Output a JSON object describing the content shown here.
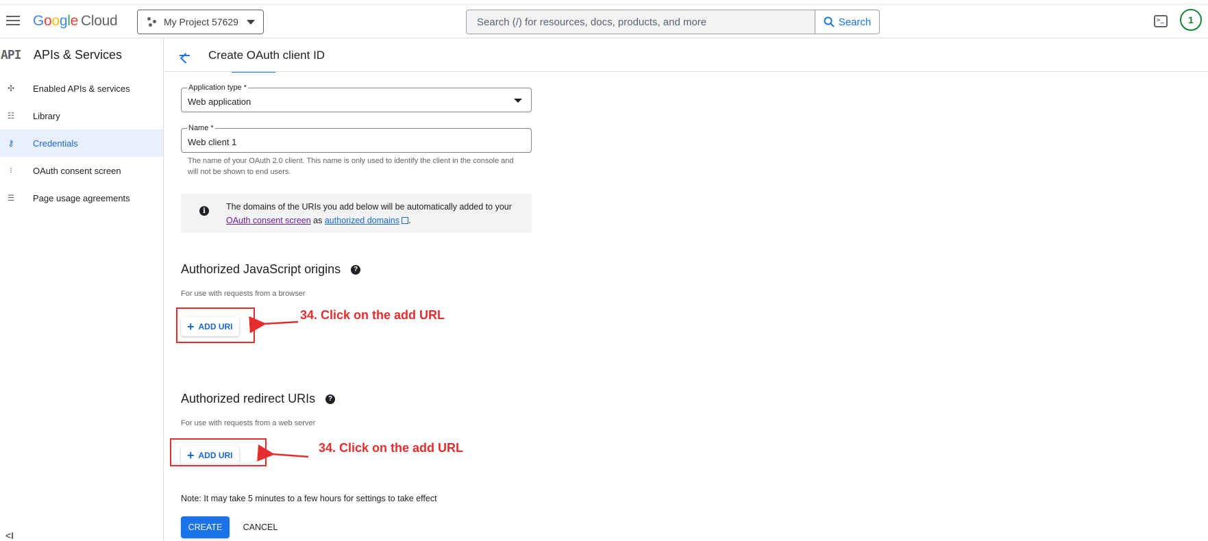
{
  "topbar": {
    "logo_google": [
      "G",
      "o",
      "o",
      "g",
      "l",
      "e"
    ],
    "logo_cloud": "Cloud",
    "project_name": "My Project 57629",
    "search_placeholder": "Search (/) for resources, docs, products, and more",
    "search_button": "Search",
    "avatar_initial": "1",
    "terminal_glyph": ">_"
  },
  "sidebar": {
    "badge": "API",
    "title": "APIs & Services",
    "items": [
      {
        "label": "Enabled APIs & services",
        "icon": "enabled-apis-icon",
        "active": false
      },
      {
        "label": "Library",
        "icon": "library-icon",
        "active": false
      },
      {
        "label": "Credentials",
        "icon": "key-icon",
        "active": true
      },
      {
        "label": "OAuth consent screen",
        "icon": "consent-icon",
        "active": false
      },
      {
        "label": "Page usage agreements",
        "icon": "agreements-icon",
        "active": false
      }
    ],
    "collapse_glyph": "<I"
  },
  "header": {
    "title": "Create OAuth client ID"
  },
  "form": {
    "app_type_label": "Application type *",
    "app_type_value": "Web application",
    "name_label": "Name *",
    "name_value": "Web client 1",
    "name_help": "The name of your OAuth 2.0 client. This name is only used to identify the client in the console and will not be shown to end users.",
    "info_prefix": "The domains of the URIs you add below will be automatically added to your",
    "info_link1": "OAuth consent screen",
    "info_mid": "as",
    "info_link2": "authorized domains",
    "info_suffix": ".",
    "js_origins_title": "Authorized JavaScript origins",
    "js_origins_sub": "For use with requests from a browser",
    "redirect_title": "Authorized redirect URIs",
    "redirect_sub": "For use with requests from a web server",
    "add_uri_label": "ADD URI",
    "note": "Note: It may take 5 minutes to a few hours for settings to take effect",
    "create_label": "CREATE",
    "cancel_label": "CANCEL"
  },
  "annotations": {
    "text1": "34. Click on the add URL",
    "text2": "34. Click on the add URL",
    "color": "#e52d2d"
  },
  "colors": {
    "accent": "#1a73e8",
    "active_bg": "#e8f0fe",
    "avatar": "#188038"
  }
}
